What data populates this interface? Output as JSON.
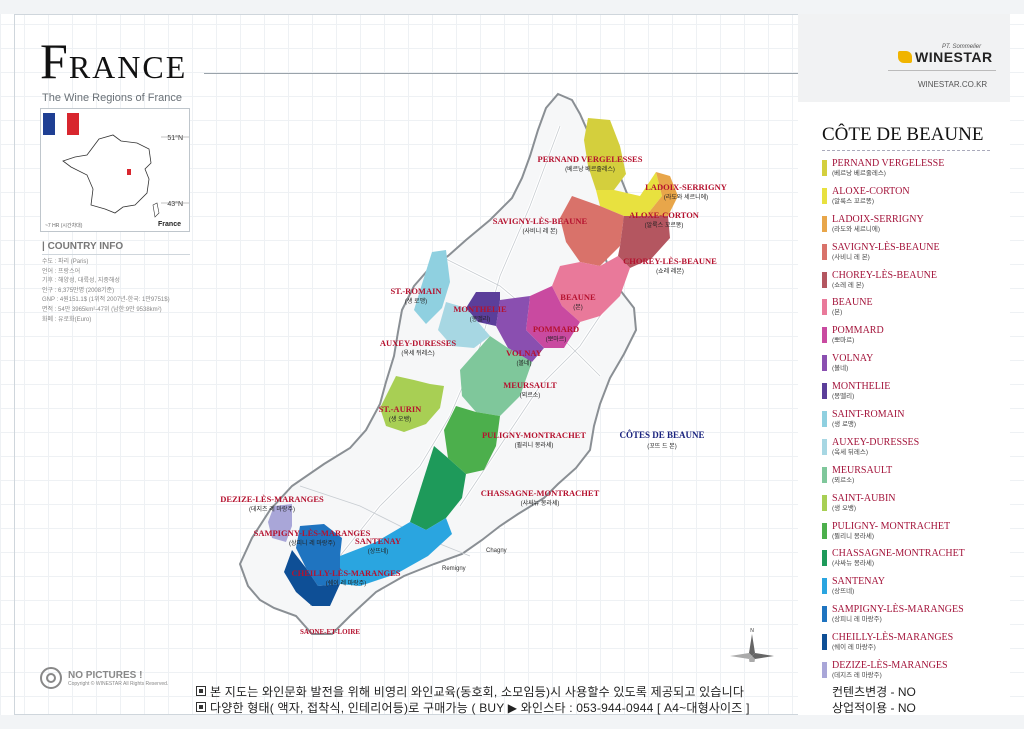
{
  "header": {
    "title_initial": "F",
    "title_rest": "RANCE",
    "subtitle": "The Wine Regions of France"
  },
  "inset": {
    "lat_north": "51°N",
    "lat_south": "43°N",
    "scale": "~7 HR (시간차대)",
    "label": "France",
    "flag_colors": [
      "#1f3f93",
      "#ffffff",
      "#d8262e"
    ]
  },
  "country_info": {
    "heading": "| COUNTRY INFO",
    "lines": [
      "수도 : 파리 (Paris)",
      "언어 : 프랑스어",
      "기후 : 해양성, 대륙성, 지중해성",
      "인구 : 6,375만명 (2008기준)",
      "GNP : 4원151.1$ (1위적 2007년-한국: 1만9751$)",
      "면적 : 54만 3965km²-47위 (남한:9만 9538km²)",
      "화폐 : 유로화(Euro)"
    ]
  },
  "brand": {
    "tag": "PT. Sommelier",
    "name": "WINESTAR",
    "url": "WINESTAR.CO.KR",
    "accent": "#f0b400"
  },
  "legend": {
    "title": "CÔTE DE BEAUNE",
    "items": [
      {
        "en": "PERNAND VERGELESSE",
        "ko": "(베르낭 베르줄레스)",
        "color": "#d4cf3d"
      },
      {
        "en": "ALOXE-CORTON",
        "ko": "(알룩스 꼬르똥)",
        "color": "#e8e13f"
      },
      {
        "en": "LADOIX-SERRIGNY",
        "ko": "(라도와 세르니에)",
        "color": "#e8a64a"
      },
      {
        "en": "SAVIGNY-LÈS-BEAUNE",
        "ko": "(사비니 레 본)",
        "color": "#d9726a"
      },
      {
        "en": "CHOREY-LÈS-BEAUNE",
        "ko": "(쇼레 레 본)",
        "color": "#b45660"
      },
      {
        "en": "BEAUNE",
        "ko": "(본)",
        "color": "#e9799a"
      },
      {
        "en": "POMMARD",
        "ko": "(뽀마르)",
        "color": "#c94aa0"
      },
      {
        "en": "VOLNAY",
        "ko": "(볼네)",
        "color": "#8a4fb0"
      },
      {
        "en": "MONTHELIE",
        "ko": "(몽뗄리)",
        "color": "#5b3e9a"
      },
      {
        "en": "SAINT-ROMAIN",
        "ko": "(생 로맹)",
        "color": "#8fd0e0"
      },
      {
        "en": "AUXEY-DURESSES",
        "ko": "(옥세 뒤레스)",
        "color": "#a7d7e3"
      },
      {
        "en": "MEURSAULT",
        "ko": "(뫼르소)",
        "color": "#7fc79b"
      },
      {
        "en": "SAINT-AUBIN",
        "ko": "(생 오뱅)",
        "color": "#a8cf54"
      },
      {
        "en": "PULIGNY- MONTRACHET",
        "ko": "(퓔리니 몽라셰)",
        "color": "#4caf4c"
      },
      {
        "en": "CHASSAGNE-MONTRACHET",
        "ko": "(샤싸뉴 몽라셰)",
        "color": "#1e9a5a"
      },
      {
        "en": "SANTENAY",
        "ko": "(상뜨네)",
        "color": "#2aa5e0"
      },
      {
        "en": "SAMPIGNY-LÈS-MARANGES",
        "ko": "(상피니 레 마랑주)",
        "color": "#1f74c0"
      },
      {
        "en": "CHEILLY-LÈS-MARANGES",
        "ko": "(쉐이 레 마랑주)",
        "color": "#0e4f96"
      },
      {
        "en": "DEZIZE-LÈS-MARANGES",
        "ko": "(데지즈 레 마랑주)",
        "color": "#a9a6d8"
      }
    ]
  },
  "map": {
    "labels": [
      {
        "en": "PERNAND VERGELESSES",
        "ko": "(베르낭 베르줄레스)"
      },
      {
        "en": "LADOIX-SERRIGNY",
        "ko": "(라도와 세르니에)"
      },
      {
        "en": "SAVIGNY-LÈS-BEAUNE",
        "ko": "(사비니 레 본)"
      },
      {
        "en": "ALOXE-CORTON",
        "ko": "(알룩스 꼬르똥)"
      },
      {
        "en": "CHOREY-LÈS-BEAUNE",
        "ko": "(쇼레 레본)"
      },
      {
        "en": "ST.-ROMAIN",
        "ko": "(생 로맹)"
      },
      {
        "en": "BEAUNE",
        "ko": "(본)"
      },
      {
        "en": "MONTHELIE",
        "ko": "(몽뗄리)"
      },
      {
        "en": "POMMARD",
        "ko": "(뽀마르)"
      },
      {
        "en": "AUXEY-DURESSES",
        "ko": "(옥세 뒤레스)"
      },
      {
        "en": "VOLNAY",
        "ko": "(볼네)"
      },
      {
        "en": "MEURSAULT",
        "ko": "(뫼르소)"
      },
      {
        "en": "ST.-AURIN",
        "ko": "(생 오뱅)"
      },
      {
        "en": "PULIGNY-MONTRACHET",
        "ko": "(퓔리니 몽라셰)"
      },
      {
        "en": "CHASSAGNE-MONTRACHET",
        "ko": "(샤싸뉴 몽라셰)"
      },
      {
        "en": "DEZIZE-LÈS-MARANGES",
        "ko": "(데지즈 레 마랑주)"
      },
      {
        "en": "SAMPIGNY-LÈS-MARANGES",
        "ko": "(상피니 레 마랑주)"
      },
      {
        "en": "SANTENAY",
        "ko": "(상뜨네)"
      },
      {
        "en": "CHEILLY-LÈS-MARANGES",
        "ko": "(쉐이 레 마랑주)"
      }
    ],
    "cotes": {
      "en": "CÔTES DE BEAUNE",
      "ko": "(꼬뜨 드 본)"
    },
    "towns": {
      "chagny": "Chagny",
      "remigny": "Remigny",
      "saone": "SAONE-ET-LOIRE"
    },
    "compass_n": "N"
  },
  "footer": {
    "no_pictures": "NO PICTURES !",
    "copyright": "Copyright © WINESTAR All Rights Reserved.",
    "line1": "본 지도는 와인문화 발전을 위해 비영리 와인교육(동호회, 소모임등)시 사용할수 있도록 제공되고 있습니다",
    "line1_right": "컨텐츠변경 - NO",
    "line2": "다양한 형태( 액자, 접착식, 인테리어등)로 구매가능 (  BUY  ▶  와인스타  :  053-944-0944  [ A4~대형사이즈 ]",
    "line2_right": "상업적이용 - NO"
  }
}
